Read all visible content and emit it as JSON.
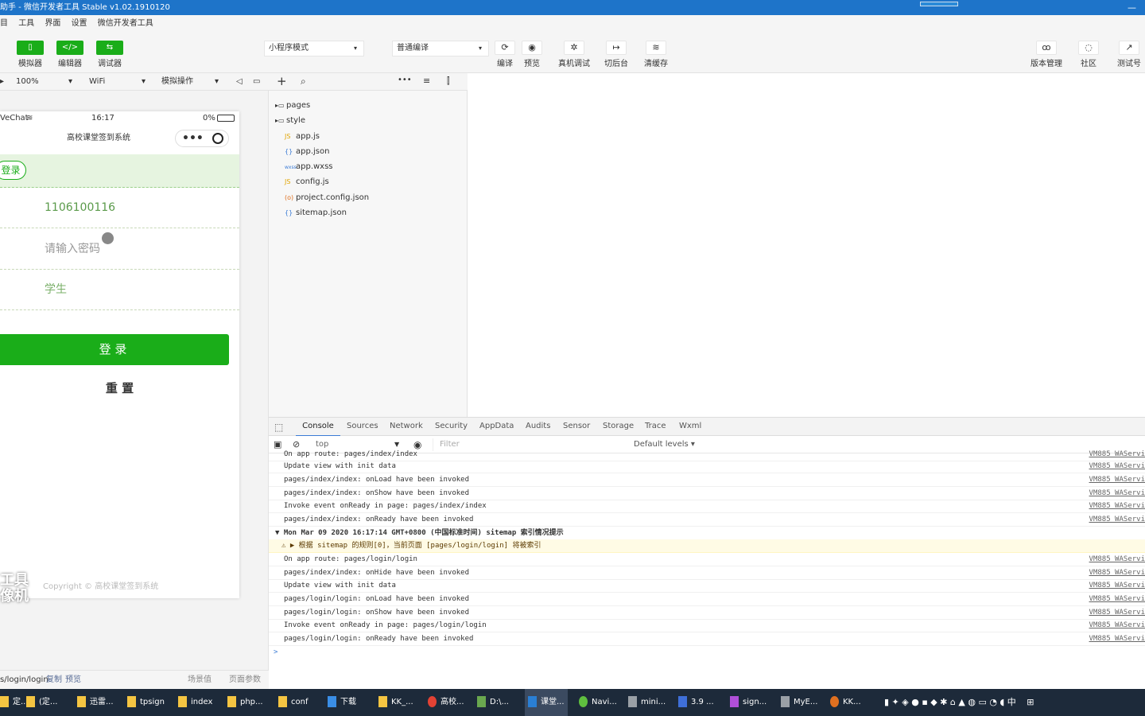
{
  "window": {
    "title": "助手 - 微信开发者工具 Stable v1.02.1910120",
    "minimize": "—"
  },
  "menu": [
    "目",
    "工具",
    "界面",
    "设置",
    "微信开发者工具"
  ],
  "toolbar": {
    "simulator": {
      "icon": "▯",
      "label": "模拟器"
    },
    "editor": {
      "icon": "</>",
      "label": "编辑器"
    },
    "debugger": {
      "icon": "⇆",
      "label": "调试器"
    },
    "mode_select": "小程序模式",
    "compile_select": "普通编译",
    "compile": {
      "icon": "⟳",
      "label": "编译"
    },
    "preview": {
      "icon": "◉",
      "label": "预览"
    },
    "device_debug": {
      "icon": "✲",
      "label": "真机调试"
    },
    "background": {
      "icon": "↦",
      "label": "切后台"
    },
    "clear_cache": {
      "icon": "≋",
      "label": "清缓存"
    },
    "version": {
      "icon": "ꝏ",
      "label": "版本管理"
    },
    "community": {
      "icon": "◌",
      "label": "社区"
    },
    "test": {
      "icon": "↗",
      "label": "测试号"
    }
  },
  "simbar": {
    "zoom": "100%",
    "network": "WiFi",
    "ops": "模拟操作"
  },
  "phone": {
    "carrier": "VeChat",
    "time": "16:17",
    "battery": "0%",
    "nav_title": "高校课堂签到系统",
    "login_tag": "登录",
    "account_value": "1106100116",
    "password_placeholder": "请输入密码",
    "role": "学生",
    "login_button": "登 录",
    "reset_button": "重 置",
    "copyright": "Copyright © 高校课堂签到系统",
    "watermark_1": "工具",
    "watermark_2": "像机"
  },
  "sim_footer": {
    "path": "s/login/login",
    "copy": "复制",
    "preview": "预览",
    "scene": "场景值",
    "params": "页面参数"
  },
  "file_tree": [
    {
      "type": "folder",
      "name": "pages"
    },
    {
      "type": "folder",
      "name": "style"
    },
    {
      "type": "js",
      "name": "app.js"
    },
    {
      "type": "json",
      "name": "app.json"
    },
    {
      "type": "wxss",
      "name": "app.wxss"
    },
    {
      "type": "js",
      "name": "config.js"
    },
    {
      "type": "config",
      "name": "project.config.json"
    },
    {
      "type": "json",
      "name": "sitemap.json"
    }
  ],
  "devtools": {
    "tabs": [
      "Console",
      "Sources",
      "Network",
      "Security",
      "AppData",
      "Audits",
      "Sensor",
      "Storage",
      "Trace",
      "Wxml"
    ],
    "context": "top",
    "filter_placeholder": "Filter",
    "levels": "Default levels ▾"
  },
  "console": [
    {
      "text": "On app route: pages/index/index",
      "src": "VM885 WAServi"
    },
    {
      "text": "Update view with init data",
      "src": "VM885 WAServi"
    },
    {
      "text": "pages/index/index: onLoad have been invoked",
      "src": "VM885 WAServi"
    },
    {
      "text": "pages/index/index: onShow have been invoked",
      "src": "VM885 WAServi"
    },
    {
      "text": "Invoke event onReady in page: pages/index/index",
      "src": "VM885 WAServi"
    },
    {
      "text": "pages/index/index: onReady have been invoked",
      "src": "VM885 WAServi"
    },
    {
      "text": "▼ Mon Mar 09 2020 16:17:14 GMT+0800 (中国标准时间) sitemap 索引情况提示",
      "src": ""
    },
    {
      "text": "⚠ ▶ 根据 sitemap 的规则[0]，当前页面 [pages/login/login] 将被索引",
      "src": "",
      "warn": true
    },
    {
      "text": "On app route: pages/login/login",
      "src": "VM885 WAServi"
    },
    {
      "text": "pages/index/index: onHide have been invoked",
      "src": "VM885 WAServi"
    },
    {
      "text": "Update view with init data",
      "src": "VM885 WAServi"
    },
    {
      "text": "pages/login/login: onLoad have been invoked",
      "src": "VM885 WAServi"
    },
    {
      "text": "pages/login/login: onShow have been invoked",
      "src": "VM885 WAServi"
    },
    {
      "text": "Invoke event onReady in page: pages/login/login",
      "src": "VM885 WAServi"
    },
    {
      "text": "pages/login/login: onReady have been invoked",
      "src": "VM885 WAServi"
    },
    {
      "text": ">",
      "src": ""
    }
  ],
  "taskbar": [
    {
      "label": "定...",
      "color": "#f5c542"
    },
    {
      "label": "(定...",
      "color": "#f5c542"
    },
    {
      "label": "迅雷...",
      "color": "#f5c542"
    },
    {
      "label": "tpsign",
      "color": "#f5c542"
    },
    {
      "label": "index",
      "color": "#f5c542"
    },
    {
      "label": "php...",
      "color": "#f5c542"
    },
    {
      "label": "conf",
      "color": "#f5c542"
    },
    {
      "label": "下载",
      "color": "#3a8ee6"
    },
    {
      "label": "KK_...",
      "color": "#f5c542"
    },
    {
      "label": "高校...",
      "color": "#e34234"
    },
    {
      "label": "D:\\...",
      "color": "#6aa84f"
    },
    {
      "label": "课堂...",
      "color": "#2a7fd4",
      "active": true
    },
    {
      "label": "Navi...",
      "color": "#5fbf3f"
    },
    {
      "label": "mini...",
      "color": "#9aa0a6"
    },
    {
      "label": "3.9 ...",
      "color": "#3f6fd8"
    },
    {
      "label": "sign...",
      "color": "#b04fd8"
    },
    {
      "label": "MyE...",
      "color": "#9aa0a6"
    },
    {
      "label": "KK...",
      "color": "#e07020"
    }
  ],
  "tray": {
    "ime": "中",
    "grid": "⊞"
  }
}
